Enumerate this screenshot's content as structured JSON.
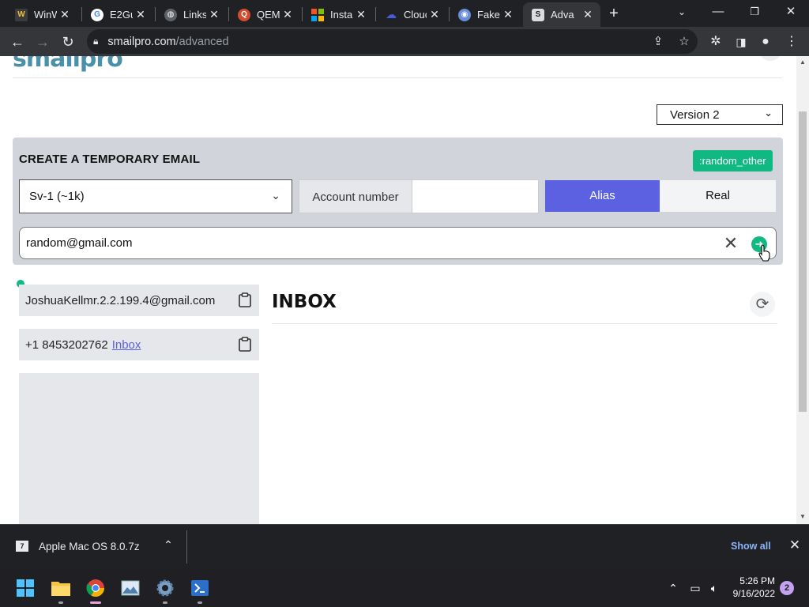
{
  "browser": {
    "tabs": [
      {
        "label": "WinW",
        "favicon": "w-icon",
        "color": "#3c3c3c"
      },
      {
        "label": "E2Gu",
        "favicon": "google-icon",
        "color": "#ffffff"
      },
      {
        "label": "Links",
        "favicon": "globe-icon",
        "color": "#5f6368"
      },
      {
        "label": "QEMU",
        "favicon": "qemu-icon",
        "color": "#d44c2c"
      },
      {
        "label": "Instal",
        "favicon": "windows-logo-icon",
        "color": "#f35325"
      },
      {
        "label": "Clouc",
        "favicon": "cloud-icon",
        "color": "#4a5bd4"
      },
      {
        "label": "Fake",
        "favicon": "fake-icon",
        "color": "#6a8fd8"
      },
      {
        "label": "Adva",
        "favicon": "s-icon",
        "color": "#dadce0",
        "active": true
      }
    ],
    "url_host": "smailpro.com",
    "url_path": "/advanced"
  },
  "page": {
    "logo": "smailpro",
    "version_select": "Version 2",
    "create_title": "CREATE A TEMPORARY EMAIL",
    "tag_badge": ":random_other",
    "server_select": "Sv-1 (~1k)",
    "account_number_label": "Account number",
    "account_number_value": "",
    "alias_label": "Alias",
    "real_label": "Real",
    "email_input_value": "random@gmail.com",
    "identity_email": "JoshuaKellmr.2.2.199.4@gmail.com",
    "identity_phone": "+1 8453202762",
    "identity_phone_link": "Inbox",
    "inbox_title": "INBOX"
  },
  "download": {
    "filename": "Apple Mac OS 8.0.7z",
    "show_all": "Show all"
  },
  "taskbar": {
    "time": "5:26 PM",
    "date": "9/16/2022",
    "notifications": "2"
  },
  "colors": {
    "accent": "#5b61e0",
    "green": "#10b981",
    "panel": "#d1d5db"
  }
}
